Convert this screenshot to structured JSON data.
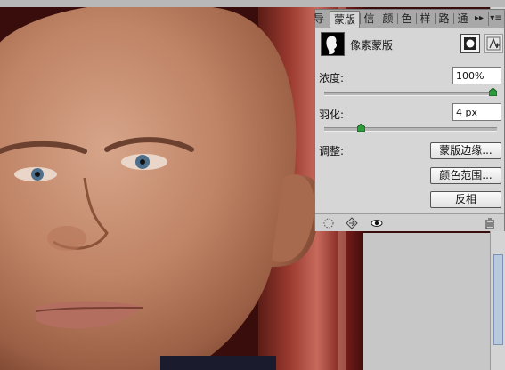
{
  "panel": {
    "tabs": [
      {
        "label": "导",
        "active": false
      },
      {
        "label": "蒙版",
        "active": true
      },
      {
        "label": "信",
        "active": false
      },
      {
        "label": "颜",
        "active": false
      },
      {
        "label": "色",
        "active": false
      },
      {
        "label": "样",
        "active": false
      },
      {
        "label": "路",
        "active": false
      },
      {
        "label": "通",
        "active": false
      }
    ],
    "collapse_glyph": "▸▸",
    "menu_glyph": "▾≡",
    "mask_type_label": "像素蒙版",
    "density": {
      "label": "浓度:",
      "value": "100%",
      "slider_fraction": 1.0
    },
    "feather": {
      "label": "羽化:",
      "value": "4 px",
      "slider_fraction": 0.2
    },
    "adjust_label": "调整:",
    "buttons": {
      "mask_edge": "蒙版边缘...",
      "color_range": "颜色范围...",
      "invert": "反相"
    }
  },
  "colors": {
    "panel_bg": "#d6d6d6",
    "tab_bar_bg": "#a8a8a8",
    "slider_thumb": "#2e9a3a"
  },
  "icons": [
    "load-selection-icon",
    "apply-mask-icon",
    "visibility-eye-icon",
    "delete-mask-icon",
    "pixel-mask-icon",
    "vector-mask-icon"
  ]
}
